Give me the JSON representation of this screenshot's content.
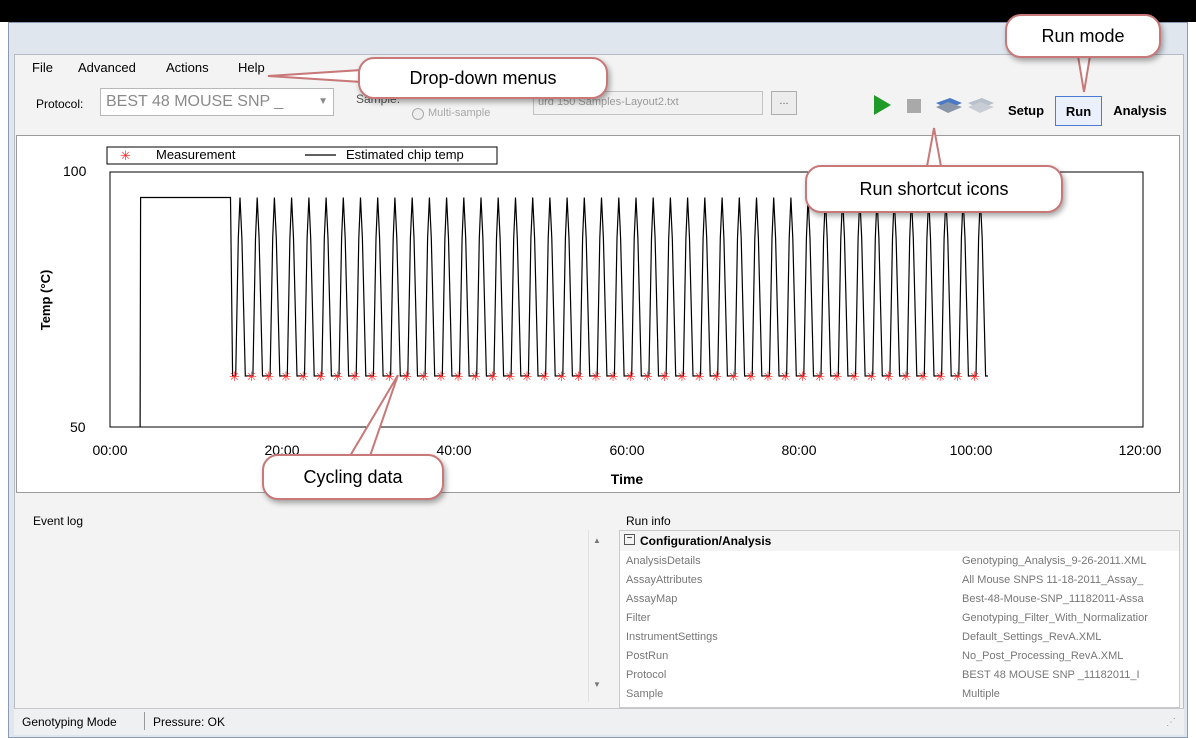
{
  "menu": {
    "file": "File",
    "advanced": "Advanced",
    "actions": "Actions",
    "help": "Help"
  },
  "protocol": {
    "label": "Protocol:",
    "value": "BEST 48 MOUSE SNP _"
  },
  "sample": {
    "label": "Sample:",
    "mode_label": "Multi-sample",
    "file": "urd 150 Samples-Layout2.txt",
    "browse": "..."
  },
  "toolbar": {
    "icons": [
      "play-icon",
      "stop-icon",
      "load-chip-icon",
      "eject-chip-icon"
    ]
  },
  "modes": {
    "setup": "Setup",
    "run": "Run",
    "analysis": "Analysis",
    "active": "Run"
  },
  "chart_data": {
    "type": "line",
    "xlabel": "Time",
    "ylabel": "Temp (°C)",
    "x_ticks": [
      "00:00",
      "20:00",
      "40:00",
      "60:00",
      "80:00",
      "100:00",
      "120:00"
    ],
    "y_ticks": [
      "100",
      "50"
    ],
    "xlim": [
      0,
      120
    ],
    "ylim": [
      50,
      100
    ],
    "legend": {
      "placement": "top-left",
      "measurement": "Measurement",
      "estimated": "Estimated chip temp"
    },
    "hold_start": 3.5,
    "hold_end": 14.0,
    "hold_temp": 95,
    "cycle_start": 14.0,
    "cycle_period": 2.0,
    "cycles": 44,
    "high_temp": 95,
    "low_temp": 60,
    "measurement_temp": 60,
    "colors": {
      "line": "#000000",
      "measurement": "#ff2020"
    }
  },
  "event_log": {
    "label": "Event log"
  },
  "run_info": {
    "label": "Run info",
    "section": "Configuration/Analysis",
    "rows": [
      {
        "key": "AnalysisDetails",
        "value": "Genotyping_Analysis_9-26-2011.XML"
      },
      {
        "key": "AssayAttributes",
        "value": "All Mouse SNPS 11-18-2011_Assay_"
      },
      {
        "key": "AssayMap",
        "value": "Best-48-Mouse-SNP_11182011-Assa"
      },
      {
        "key": "Filter",
        "value": "Genotyping_Filter_With_Normalizatior"
      },
      {
        "key": "InstrumentSettings",
        "value": "Default_Settings_RevA.XML"
      },
      {
        "key": "PostRun",
        "value": "No_Post_Processing_RevA.XML"
      },
      {
        "key": "Protocol",
        "value": "BEST 48 MOUSE SNP _11182011_I"
      },
      {
        "key": "Sample",
        "value": "Multiple"
      }
    ]
  },
  "status": {
    "mode": "Genotyping Mode",
    "pressure": "Pressure: OK"
  },
  "callouts": {
    "menus": "Drop-down menus",
    "run_mode": "Run mode",
    "shortcuts": "Run shortcut icons",
    "cycling": "Cycling data"
  }
}
